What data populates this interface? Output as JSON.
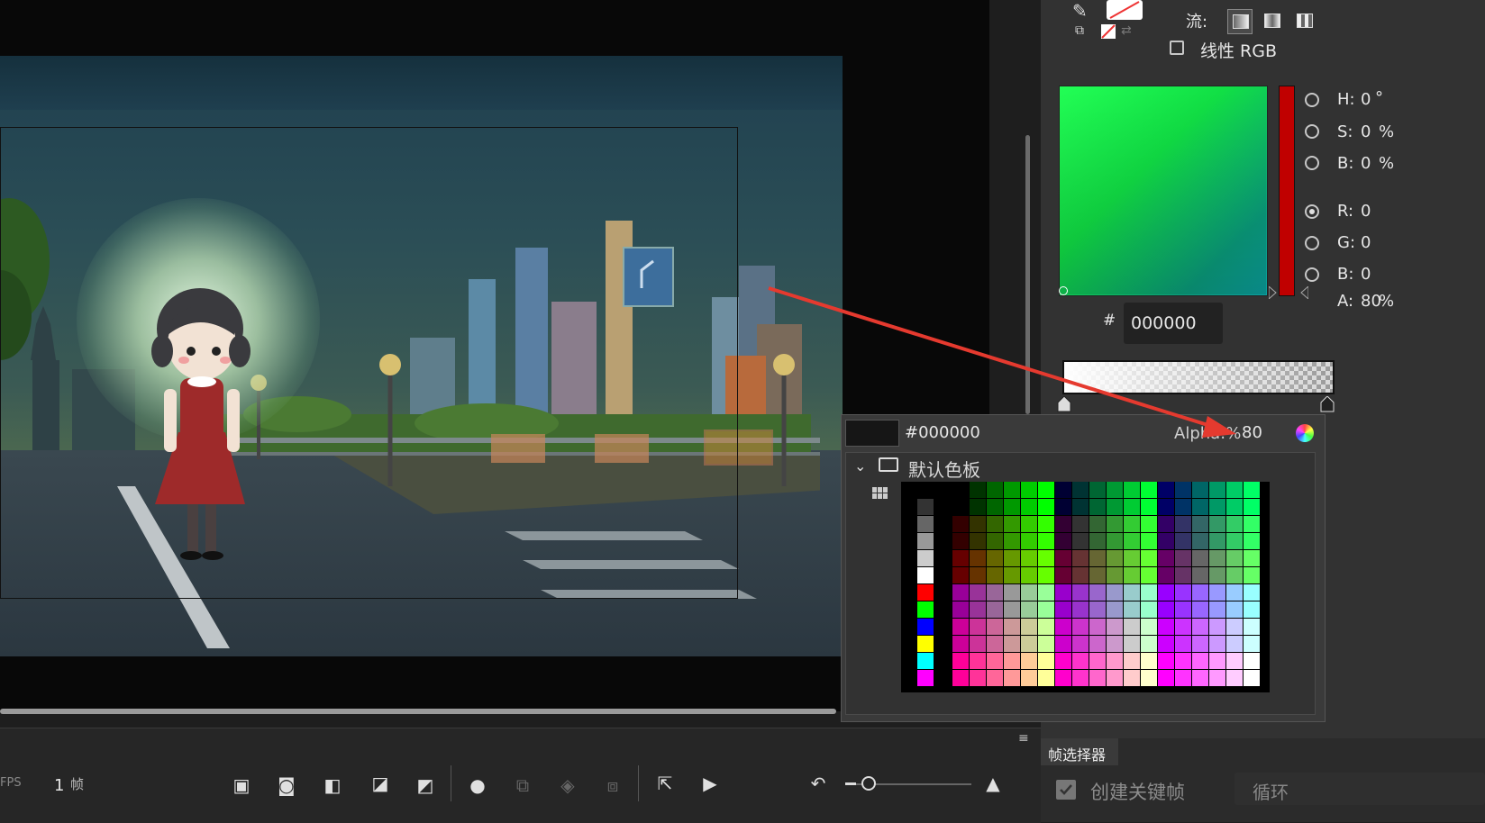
{
  "color_panel": {
    "flow_label": "流:",
    "linear_rgb_label": "线性 RGB",
    "h_label": "H:",
    "h_value": "0",
    "h_unit": "°",
    "s_label": "S:",
    "s_value": "0",
    "s_unit": "%",
    "b_label": "B:",
    "b_value": "0",
    "b_unit": "%",
    "r_label": "R:",
    "r_value": "0",
    "g_label": "G:",
    "g_value": "0",
    "b2_label": "B:",
    "b2_value": "0",
    "a_label": "A:",
    "a_value": "80",
    "a_unit": "%",
    "hex_prefix": "#",
    "hex_value": "000000"
  },
  "swatch_popup": {
    "hex_value": "#000000",
    "alpha_label": "Alpha:%",
    "alpha_value": "80",
    "folder_label": "默认色板"
  },
  "timeline": {
    "fps_label": "FPS",
    "frame_value": "1",
    "frame_unit": "帧"
  },
  "frame_selector": {
    "title": "帧选择器",
    "create_keyframe_label": "创建关键帧",
    "loop_label": "循环"
  },
  "colors": {
    "accent_arrow": "#e53a2f",
    "selected_color": "#000000"
  }
}
